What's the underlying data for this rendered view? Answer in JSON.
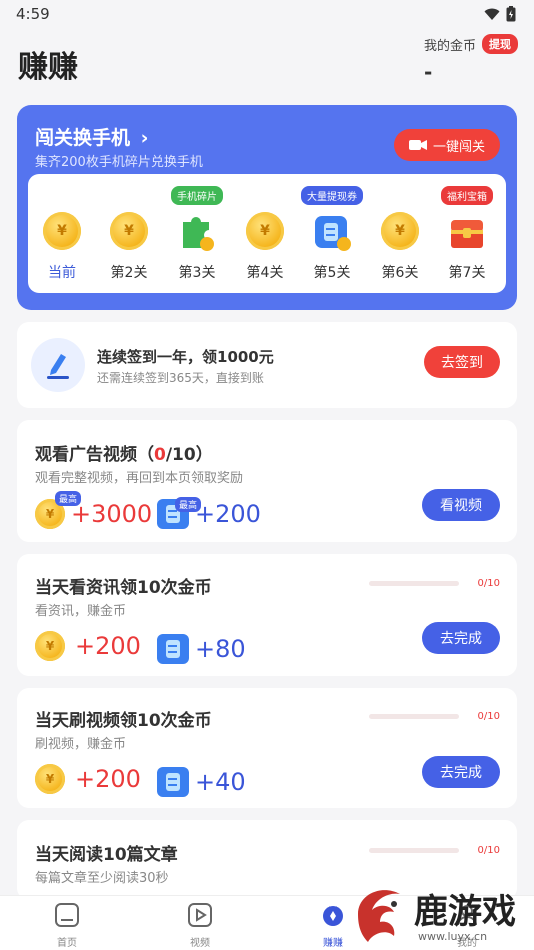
{
  "status_bar": {
    "time": "4:59"
  },
  "header": {
    "title": "赚赚",
    "coins_label": "我的金币",
    "withdraw": "提现",
    "coins_value": "-"
  },
  "hero": {
    "title": "闯关换手机",
    "subtitle": "集齐200枚手机碎片兑换手机",
    "button": "一键闯关",
    "levels": [
      {
        "label": "当前",
        "icon": "coin-icon",
        "tag": ""
      },
      {
        "label": "第2关",
        "icon": "coin-icon",
        "tag": ""
      },
      {
        "label": "第3关",
        "icon": "puzzle-piece-icon",
        "tag": "手机碎片"
      },
      {
        "label": "第4关",
        "icon": "coin-icon",
        "tag": ""
      },
      {
        "label": "第5关",
        "icon": "ticket-icon",
        "tag": "大量提现券"
      },
      {
        "label": "第6关",
        "icon": "coin-icon",
        "tag": ""
      },
      {
        "label": "第7关",
        "icon": "treasure-chest-icon",
        "tag": "福利宝箱"
      }
    ]
  },
  "signin": {
    "title": "连续签到一年，领1000元",
    "subtitle": "还需连续签到365天，直接到账",
    "button": "去签到"
  },
  "tasks": [
    {
      "title_prefix": "观看广告视频（",
      "progress_done": "0",
      "progress_total": "/10）",
      "subtitle": "观看完整视频，再回到本页领取奖励",
      "coin_reward": "+3000",
      "ticket_reward": "+200",
      "high_tag": "最高",
      "button": "看视频"
    },
    {
      "title": "当天看资讯领10次金币",
      "subtitle": "看资讯，赚金币",
      "coin_reward": "+200",
      "ticket_reward": "+80",
      "progress": "0/10",
      "button": "去完成"
    },
    {
      "title": "当天刷视频领10次金币",
      "subtitle": "刷视频，赚金币",
      "coin_reward": "+200",
      "ticket_reward": "+40",
      "progress": "0/10",
      "button": "去完成"
    },
    {
      "title": "当天阅读10篇文章",
      "subtitle": "每篇文章至少阅读30秒",
      "progress": "0/10"
    }
  ],
  "tabbar": [
    {
      "label": "首页",
      "icon": "home-icon"
    },
    {
      "label": "视频",
      "icon": "video-icon"
    },
    {
      "label": "赚赚",
      "icon": "earn-icon"
    },
    {
      "label": "我的",
      "icon": "profile-icon"
    }
  ],
  "watermark": {
    "text": "鹿游戏",
    "url": "www.luyx.cn"
  },
  "colors": {
    "primary": "#5574ef",
    "accent_red": "#f0413a",
    "button_blue": "#4561e6",
    "coin": "#f5b51d"
  }
}
